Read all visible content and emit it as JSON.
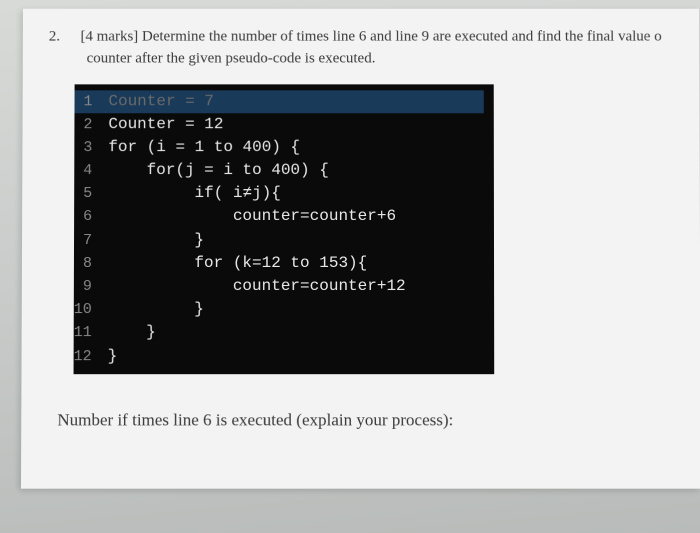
{
  "question": {
    "number": "2.",
    "text_line1": "[4 marks] Determine the number of times line 6 and line 9 are executed and find the final value o",
    "text_line2": "counter after the given pseudo-code is executed."
  },
  "code": {
    "lines": [
      {
        "n": "1",
        "t": "Counter = 7",
        "dim": true
      },
      {
        "n": "2",
        "t": "Counter = 12"
      },
      {
        "n": "3",
        "t": "for (i = 1 to 400) {"
      },
      {
        "n": "4",
        "t": "    for(j = i to 400) {"
      },
      {
        "n": "5",
        "t": "         if( i≠j){"
      },
      {
        "n": "6",
        "t": "             counter=counter+6"
      },
      {
        "n": "7",
        "t": "         }"
      },
      {
        "n": "8",
        "t": "         for (k=12 to 153){"
      },
      {
        "n": "9",
        "t": "             counter=counter+12"
      },
      {
        "n": "10",
        "t": "         }"
      },
      {
        "n": "11",
        "t": "    }"
      },
      {
        "n": "12",
        "t": "}"
      }
    ]
  },
  "prompt": "Number if times line 6 is executed (explain your process):"
}
